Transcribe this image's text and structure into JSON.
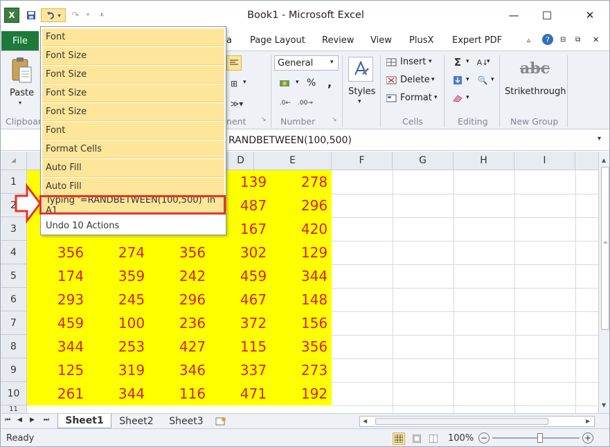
{
  "window": {
    "title": "Book1 - Microsoft Excel",
    "min": "—",
    "max": "☐",
    "close": "✕"
  },
  "tabs": {
    "file": "File",
    "visible": [
      "a",
      "Page Layout",
      "Review",
      "View",
      "PlusX",
      "Expert PDF"
    ]
  },
  "ribbon": {
    "paste": "Paste",
    "clipboard_label": "Clipboar",
    "alignment_label": "nent",
    "number_format": "General",
    "number_label": "Number",
    "styles": "Styles",
    "insert": "Insert",
    "delete": "Delete",
    "format": "Format",
    "cells_label": "Cells",
    "editing_label": "Editing",
    "strikethrough_icon_text": "abc",
    "strikethrough": "Strikethrough",
    "newgroup_label": "New Group",
    "percent": "%",
    "comma": ","
  },
  "formula_bar": {
    "formula": "RANDBETWEEN(100,500)"
  },
  "grid": {
    "columns": [
      "D",
      "E",
      "F",
      "G",
      "H",
      "I"
    ],
    "rows": [
      "1",
      "2",
      "3",
      "4",
      "5",
      "6",
      "7",
      "8",
      "9",
      "10",
      "11"
    ],
    "rows_1_3": [
      [
        "139",
        "278"
      ],
      [
        "487",
        "296"
      ],
      [
        "167",
        "420"
      ]
    ],
    "rows_4_10": [
      [
        "356",
        "274",
        "356",
        "302",
        "129"
      ],
      [
        "174",
        "359",
        "242",
        "459",
        "344"
      ],
      [
        "293",
        "245",
        "296",
        "467",
        "148"
      ],
      [
        "459",
        "100",
        "236",
        "372",
        "156"
      ],
      [
        "344",
        "253",
        "427",
        "115",
        "356"
      ],
      [
        "125",
        "319",
        "346",
        "337",
        "273"
      ],
      [
        "261",
        "344",
        "116",
        "471",
        "192"
      ]
    ]
  },
  "undo_menu": {
    "items": [
      "Font",
      "Font Size",
      "Font Size",
      "Font Size",
      "Font Size",
      "Font",
      "Format Cells",
      "Auto Fill",
      "Auto Fill",
      "Typing '=RANDBETWEEN(100,500)' in A1"
    ],
    "footer": "Undo 10 Actions"
  },
  "sheets": [
    "Sheet1",
    "Sheet2",
    "Sheet3"
  ],
  "status": {
    "ready": "Ready",
    "zoom": "100%",
    "zoom_fraction": 0.55
  },
  "colors": {
    "accent_file_tab": "#1d7a3a",
    "cell_fill": "#ffff00",
    "cell_text": "#d61f1f",
    "menu_highlight": "#fde69a",
    "callout_red": "#e53325"
  },
  "icons": [
    "excel-logo-icon",
    "save-icon",
    "undo-icon",
    "redo-icon",
    "paste-icon",
    "help-icon",
    "styles-icon",
    "sum-icon",
    "sort-filter-icon",
    "find-select-icon",
    "fill-icon",
    "clear-icon",
    "arrow-callout-icon",
    "new-sheet-icon",
    "normal-view-icon",
    "page-layout-view-icon",
    "page-break-view-icon",
    "zoom-out-icon",
    "zoom-in-icon"
  ]
}
